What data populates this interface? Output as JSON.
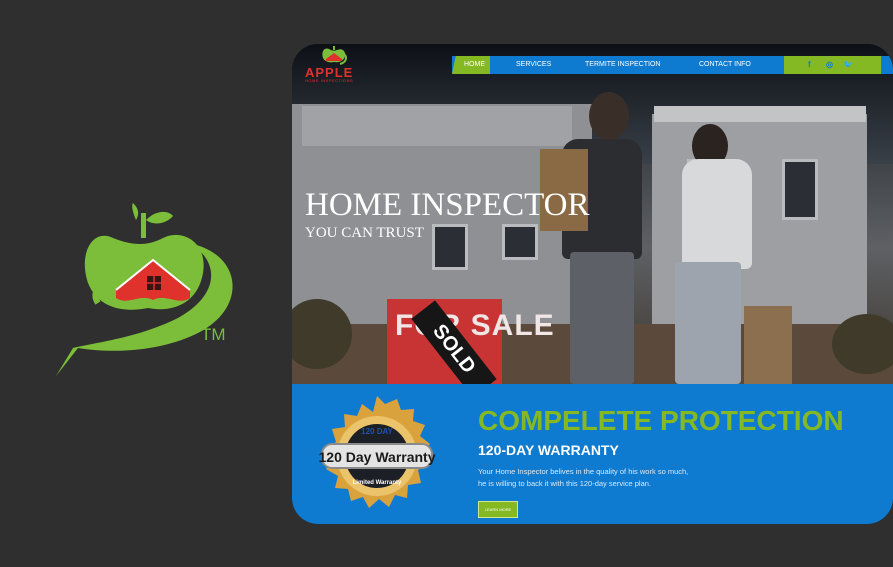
{
  "brand": {
    "name": "APPLE",
    "tagline": "HOME INSPECTIONS",
    "trademark": "TM",
    "colors": {
      "green": "#84b923",
      "red": "#e0322d",
      "blue": "#0f7bd0"
    }
  },
  "nav": {
    "items": [
      "HOME",
      "SERVICES",
      "TERMITE INSPECTION",
      "CONTACT INFO"
    ],
    "social": [
      "f",
      "◎",
      "🐦"
    ]
  },
  "hero": {
    "title": "HOME INSPECTOR",
    "subtitle": "YOU CAN TRUST",
    "sign_text": "FOR SALE",
    "sold_text": "SOLD"
  },
  "promo": {
    "title": "COMPELETE PROTECTION",
    "subtitle": "120-DAY WARRANTY",
    "body_line1": "Your Home Inspector belives in the quality of his work so much,",
    "body_line2": "he is willing to back it with this 120-day service plan.",
    "button": "LEARN MORE",
    "seal": {
      "top_text": "120 DAY",
      "main_text": "120 Day Warranty",
      "bottom_text": "Limited Warranty"
    }
  }
}
